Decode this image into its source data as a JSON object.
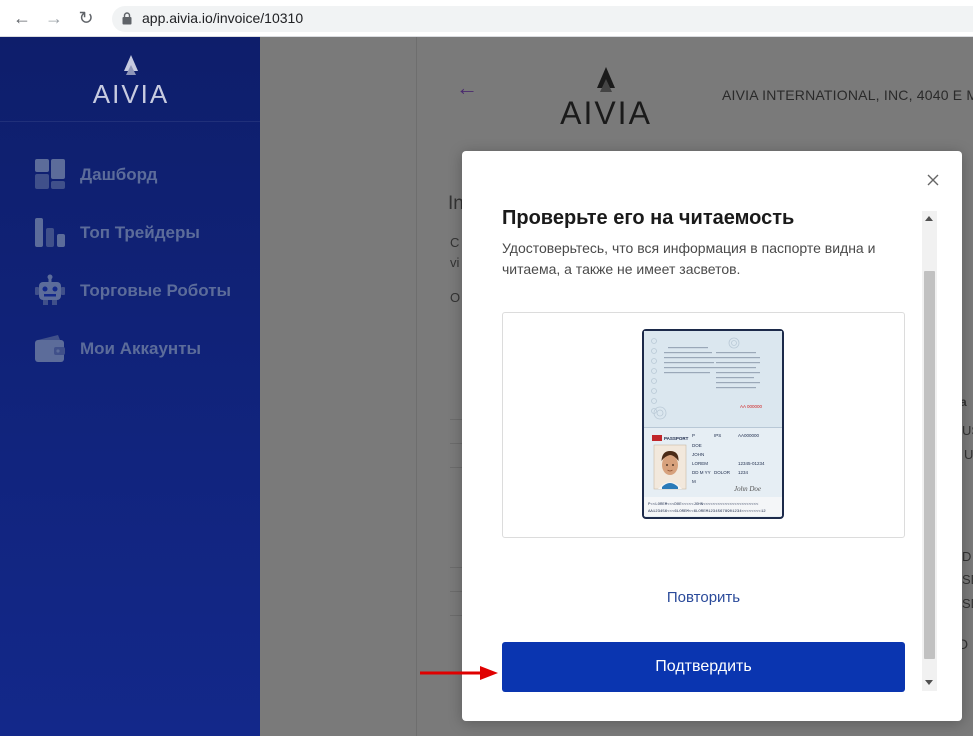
{
  "browser": {
    "url": "app.aivia.io/invoice/10310",
    "back_glyph": "←",
    "forward_glyph": "→",
    "reload_glyph": "↻"
  },
  "brand": {
    "logo_text": "AIVIA"
  },
  "sidebar": {
    "items": [
      {
        "label": "Дашборд",
        "icon": "dashboard-icon"
      },
      {
        "label": "Топ Трейдеры",
        "icon": "bar-chart-icon"
      },
      {
        "label": "Торговые Роботы",
        "icon": "robot-icon"
      },
      {
        "label": "Мои Аккаунты",
        "icon": "wallet-icon"
      }
    ]
  },
  "main": {
    "back_glyph": "←",
    "company_line": "AIVIA INTERNATIONAL, INC, 4040 E M",
    "fragments": [
      "In",
      "C",
      "vi",
      "O",
      "a",
      "US",
      "U",
      "D",
      "SD",
      "SD",
      "D U"
    ]
  },
  "modal": {
    "title": "Проверьте его на читаемость",
    "description": "Удостоверьтесь, что вся информация в паспорте видна и читаема, а также не имеет засветов.",
    "retry_label": "Повторить",
    "confirm_label": "Подтвердить",
    "passport": {
      "header": "PASSPORT",
      "type": "P",
      "country": "IPS",
      "number": "AA000000",
      "surname": "DOE",
      "given_name": "JOHN",
      "nationality": "LOREM",
      "dob_label": "DD M YY",
      "place": "DOLOR",
      "sex": "M",
      "personal_no": "12345-01234",
      "extra": "1234",
      "red_number": "AA 000000",
      "signature": "John Doe",
      "mrz1": "P<<LOREM<<<DOE<<<<<JOHN<<<<<<<<<<<<<<<<<<<<<<<",
      "mrz2": "AA123456<<<6LOREM<<6LOREM12345678901234<<<<<<<<12"
    }
  },
  "colors": {
    "sidebar": "#13288a",
    "confirm": "#0a35b0",
    "link": "#2a4a9a",
    "annotation_arrow": "#e00000"
  }
}
